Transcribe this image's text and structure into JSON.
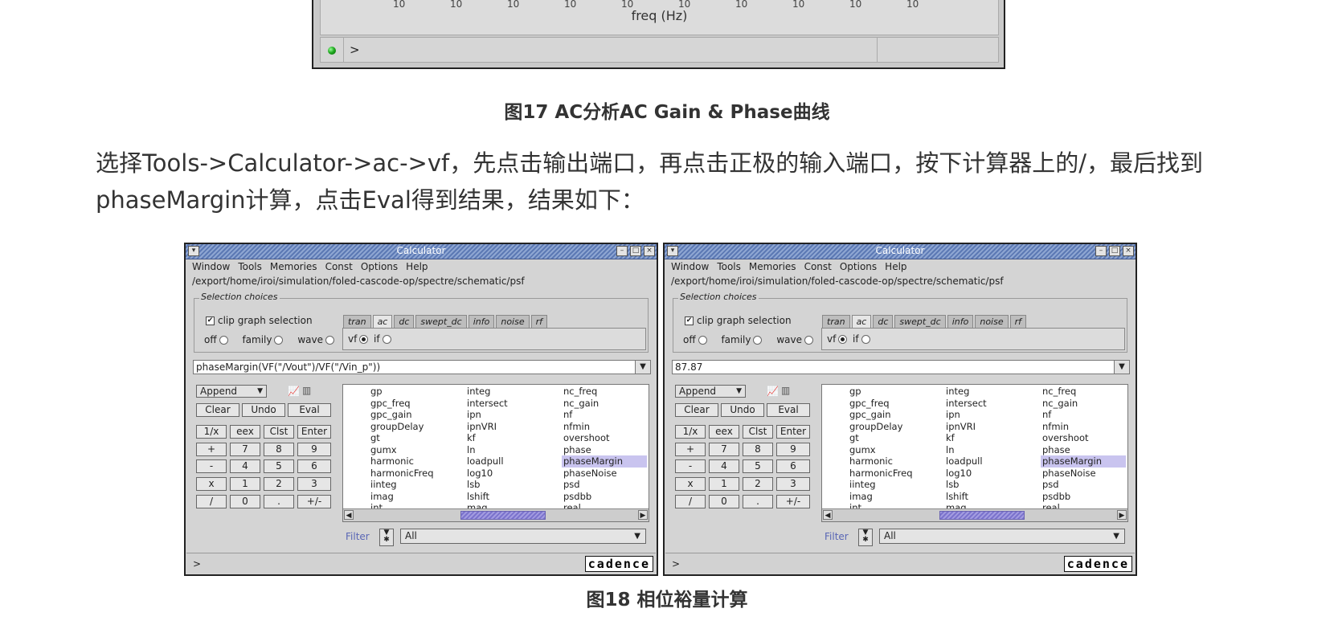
{
  "waveform": {
    "ticks": [
      "10",
      "10",
      "10",
      "10",
      "10",
      "10",
      "10",
      "10",
      "10",
      "10"
    ],
    "xlabel": "freq (Hz)",
    "prompt": ">"
  },
  "fig17_caption": "图17 AC分析AC Gain & Phase曲线",
  "paragraph": "选择Tools->Calculator->ac->vf，先点击输出端口，再点击正极的输入端口，按下计算器上的/，最后找到phaseMargin计算，点击Eval得到结果，结果如下：",
  "fig18_caption": "图18 相位裕量计算",
  "calculators": [
    {
      "title": "Calculator",
      "menu": [
        "Window",
        "Tools",
        "Memories",
        "Const",
        "Options",
        "Help"
      ],
      "path": "/export/home/iroi/simulation/foled-cascode-op/spectre/schematic/psf",
      "selection_label": "Selection choices",
      "clip_label": "clip graph selection",
      "radios": [
        "off",
        "family",
        "wave"
      ],
      "tabs": [
        "tran",
        "ac",
        "dc",
        "swept_dc",
        "info",
        "noise",
        "rf"
      ],
      "active_tab": "ac",
      "sub_radios": [
        "vf",
        "if"
      ],
      "expression": "phaseMargin(VF(\"/Vout\")/VF(\"/Vin_p\"))",
      "append_label": "Append",
      "buttons": {
        "row1": [
          "Clear",
          "Undo",
          "Eval"
        ],
        "row2": [
          "1/x",
          "eex",
          "Clst",
          "Enter"
        ],
        "row3": [
          "+",
          "7",
          "8",
          "9"
        ],
        "row4": [
          "-",
          "4",
          "5",
          "6"
        ],
        "row5": [
          "x",
          "1",
          "2",
          "3"
        ],
        "row6": [
          "/",
          "0",
          ".",
          "+/-"
        ]
      },
      "functions": {
        "col1": [
          "gp",
          "gpc_freq",
          "gpc_gain",
          "groupDelay",
          "gt",
          "gumx",
          "harmonic",
          "harmonicFreq",
          "iinteg",
          "imag",
          "int"
        ],
        "col2": [
          "integ",
          "intersect",
          "ipn",
          "ipnVRI",
          "kf",
          "ln",
          "loadpull",
          "log10",
          "lsb",
          "lshift",
          "mag"
        ],
        "col3": [
          "nc_freq",
          "nc_gain",
          "nf",
          "nfmin",
          "overshoot",
          "phase",
          "phaseMargin",
          "phaseNoise",
          "psd",
          "psdbb",
          "real"
        ]
      },
      "selected_function": "phaseMargin",
      "filter_label": "Filter",
      "filter_value": "All",
      "status_prompt": ">",
      "logo": "cadence"
    },
    {
      "title": "Calculator",
      "menu": [
        "Window",
        "Tools",
        "Memories",
        "Const",
        "Options",
        "Help"
      ],
      "path": "/export/home/iroi/simulation/foled-cascode-op/spectre/schematic/psf",
      "selection_label": "Selection choices",
      "clip_label": "clip graph selection",
      "radios": [
        "off",
        "family",
        "wave"
      ],
      "tabs": [
        "tran",
        "ac",
        "dc",
        "swept_dc",
        "info",
        "noise",
        "rf"
      ],
      "active_tab": "ac",
      "sub_radios": [
        "vf",
        "if"
      ],
      "expression": "87.87",
      "append_label": "Append",
      "buttons": {
        "row1": [
          "Clear",
          "Undo",
          "Eval"
        ],
        "row2": [
          "1/x",
          "eex",
          "Clst",
          "Enter"
        ],
        "row3": [
          "+",
          "7",
          "8",
          "9"
        ],
        "row4": [
          "-",
          "4",
          "5",
          "6"
        ],
        "row5": [
          "x",
          "1",
          "2",
          "3"
        ],
        "row6": [
          "/",
          "0",
          ".",
          "+/-"
        ]
      },
      "functions": {
        "col1": [
          "gp",
          "gpc_freq",
          "gpc_gain",
          "groupDelay",
          "gt",
          "gumx",
          "harmonic",
          "harmonicFreq",
          "iinteg",
          "imag",
          "int"
        ],
        "col2": [
          "integ",
          "intersect",
          "ipn",
          "ipnVRI",
          "kf",
          "ln",
          "loadpull",
          "log10",
          "lsb",
          "lshift",
          "mag"
        ],
        "col3": [
          "nc_freq",
          "nc_gain",
          "nf",
          "nfmin",
          "overshoot",
          "phase",
          "phaseMargin",
          "phaseNoise",
          "psd",
          "psdbb",
          "real"
        ]
      },
      "selected_function": "phaseMargin",
      "filter_label": "Filter",
      "filter_value": "All",
      "status_prompt": ">",
      "logo": "cadence"
    }
  ]
}
